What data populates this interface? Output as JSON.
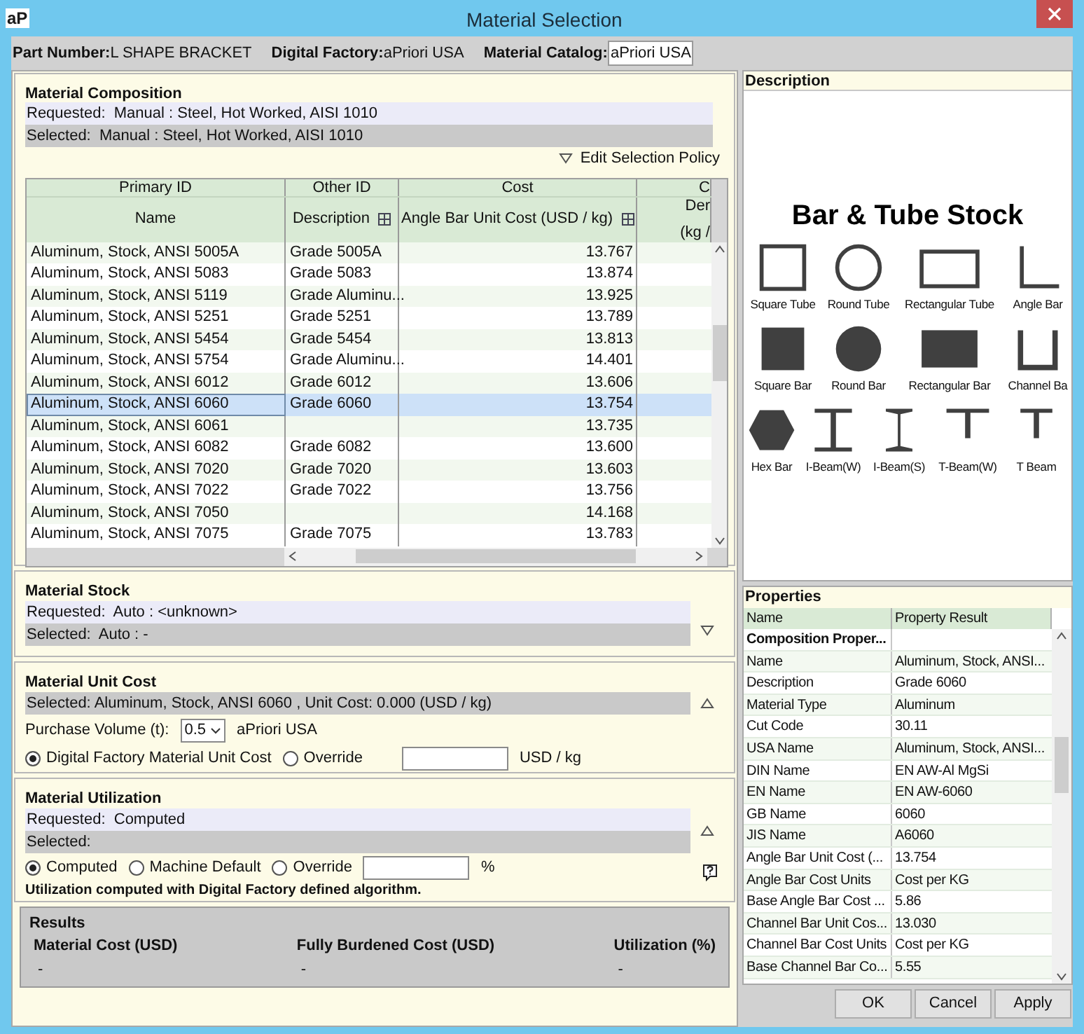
{
  "window": {
    "title": "Material Selection",
    "app_icon": "aP"
  },
  "header": [
    {
      "label": "Part Number:",
      "value": "L SHAPE BRACKET",
      "kind": "plain"
    },
    {
      "label": "Digital Factory:",
      "value": "aPriori USA",
      "kind": "plain"
    },
    {
      "label": "Material Catalog:",
      "value": "aPriori USA",
      "kind": "boxed"
    }
  ],
  "composition": {
    "title": "Material Composition",
    "requested": "Requested:  Manual : Steel, Hot Worked, AISI 1010",
    "selected": "Selected:  Manual : Steel, Hot Worked, AISI 1010",
    "policy": "Edit Selection Policy"
  },
  "table": {
    "groups": [
      "Primary ID",
      "Other ID",
      "Cost",
      "C"
    ],
    "columns": [
      {
        "label": "Name",
        "expand_icon": false
      },
      {
        "label": "Description",
        "expand_icon": true
      },
      {
        "label": "Angle Bar Unit Cost (USD / kg)",
        "expand_icon": true
      },
      {
        "label": "Der",
        "label2": "(kg /",
        "expand_icon": false
      }
    ],
    "rows": [
      {
        "name": "Aluminum, Stock, ANSI 5005A",
        "description": "Grade 5005A",
        "cost": "13.767",
        "selected": false
      },
      {
        "name": "Aluminum, Stock, ANSI 5083",
        "description": "Grade 5083",
        "cost": "13.874",
        "selected": false
      },
      {
        "name": "Aluminum, Stock, ANSI 5119",
        "description": "Grade Aluminu...",
        "cost": "13.925",
        "selected": false
      },
      {
        "name": "Aluminum, Stock, ANSI 5251",
        "description": "Grade 5251",
        "cost": "13.789",
        "selected": false
      },
      {
        "name": "Aluminum, Stock, ANSI 5454",
        "description": "Grade 5454",
        "cost": "13.813",
        "selected": false
      },
      {
        "name": "Aluminum, Stock, ANSI 5754",
        "description": "Grade Aluminu...",
        "cost": "14.401",
        "selected": false
      },
      {
        "name": "Aluminum, Stock, ANSI 6012",
        "description": "Grade 6012",
        "cost": "13.606",
        "selected": false
      },
      {
        "name": "Aluminum, Stock, ANSI 6060",
        "description": "Grade 6060",
        "cost": "13.754",
        "selected": true
      },
      {
        "name": "Aluminum, Stock, ANSI 6061",
        "cost": "13.735",
        "selected": false
      },
      {
        "name": "Aluminum, Stock, ANSI 6082",
        "description": "Grade 6082",
        "cost": "13.600",
        "selected": false
      },
      {
        "name": "Aluminum, Stock, ANSI 7020",
        "description": "Grade 7020",
        "cost": "13.603",
        "selected": false
      },
      {
        "name": "Aluminum, Stock, ANSI 7022",
        "description": "Grade 7022",
        "cost": "13.756",
        "selected": false
      },
      {
        "name": "Aluminum, Stock, ANSI 7050",
        "cost": "14.168",
        "selected": false
      },
      {
        "name": "Aluminum, Stock, ANSI 7075",
        "description": "Grade 7075",
        "cost": "13.783",
        "selected": false
      }
    ]
  },
  "stock": {
    "title": "Material Stock",
    "requested": "Requested:  Auto : <unknown>",
    "selected": "Selected:  Auto : -",
    "expanded": false
  },
  "unit_cost": {
    "title": "Material Unit Cost",
    "selected": "Selected: Aluminum, Stock, ANSI 6060 , Unit Cost: 0.000 (USD / kg)",
    "purchase_volume_label": "Purchase Volume (t):",
    "purchase_volume": "0.5",
    "factory": "aPriori USA",
    "options": [
      {
        "label": "Digital Factory Material Unit Cost",
        "selected": true
      },
      {
        "label": "Override",
        "selected": false
      }
    ],
    "unit": "USD / kg",
    "expanded": true
  },
  "utilization": {
    "title": "Material Utilization",
    "requested": "Requested:  Computed",
    "selected": "Selected:",
    "options": [
      {
        "label": "Computed",
        "selected": true
      },
      {
        "label": "Machine Default",
        "selected": false
      },
      {
        "label": "Override",
        "selected": false
      }
    ],
    "unit": "%",
    "note": "Utilization computed with Digital Factory defined algorithm.",
    "expanded": true
  },
  "results": {
    "title": "Results",
    "columns": [
      {
        "label": "Material Cost (USD)",
        "value": "-"
      },
      {
        "label": "Fully Burdened Cost (USD)",
        "value": "-"
      },
      {
        "label": "Utilization (%)",
        "value": "-"
      }
    ]
  },
  "description": {
    "title": "Description",
    "picture_title": "Bar & Tube Stock",
    "shapes": [
      {
        "kind": "square-tube",
        "label": "Square Tube"
      },
      {
        "kind": "round-tube",
        "label": "Round Tube"
      },
      {
        "kind": "rect-tube",
        "label": "Rectangular Tube"
      },
      {
        "kind": "angle",
        "label": "Angle Bar"
      },
      {
        "kind": "square-bar",
        "label": "Square Bar"
      },
      {
        "kind": "round-bar",
        "label": "Round Bar"
      },
      {
        "kind": "rect-bar",
        "label": "Rectangular Bar"
      },
      {
        "kind": "channel",
        "label": "Channel Ba"
      },
      {
        "kind": "hex",
        "label": "Hex Bar"
      },
      {
        "kind": "ibeam-w",
        "label": "I-Beam(W)"
      },
      {
        "kind": "ibeam-s",
        "label": "I-Beam(S)"
      },
      {
        "kind": "tbeam-w",
        "label": "T-Beam(W)"
      },
      {
        "kind": "tbeam",
        "label": "T Beam"
      }
    ]
  },
  "properties": {
    "title": "Properties",
    "columns": [
      "Name",
      "Property Result"
    ],
    "rows": [
      {
        "name": "Composition Proper...",
        "kind": "group"
      },
      {
        "name": "Name",
        "value": "Aluminum, Stock, ANSI...",
        "kind": "item"
      },
      {
        "name": "Description",
        "value": "Grade 6060",
        "kind": "item"
      },
      {
        "name": "Material Type",
        "value": "Aluminum",
        "kind": "item"
      },
      {
        "name": "Cut Code",
        "value": "30.11",
        "kind": "item"
      },
      {
        "name": "USA Name",
        "value": "Aluminum, Stock, ANSI...",
        "kind": "item"
      },
      {
        "name": "DIN Name",
        "value": "EN AW-Al MgSi",
        "kind": "item"
      },
      {
        "name": "EN Name",
        "value": "EN AW-6060",
        "kind": "item"
      },
      {
        "name": "GB Name",
        "value": "6060",
        "kind": "item"
      },
      {
        "name": "JIS Name",
        "value": "A6060",
        "kind": "item"
      },
      {
        "name": "Angle Bar Unit Cost (...",
        "value": "13.754",
        "kind": "item"
      },
      {
        "name": "Angle Bar Cost Units",
        "value": "Cost per KG",
        "kind": "item"
      },
      {
        "name": "Base Angle Bar Cost ...",
        "value": "5.86",
        "kind": "item"
      },
      {
        "name": "Channel Bar Unit Cos...",
        "value": "13.030",
        "kind": "item"
      },
      {
        "name": "Channel Bar Cost Units",
        "value": "Cost per KG",
        "kind": "item"
      },
      {
        "name": "Base Channel Bar Co...",
        "value": "5.55",
        "kind": "item"
      }
    ]
  },
  "buttons": [
    "OK",
    "Cancel",
    "Apply"
  ]
}
